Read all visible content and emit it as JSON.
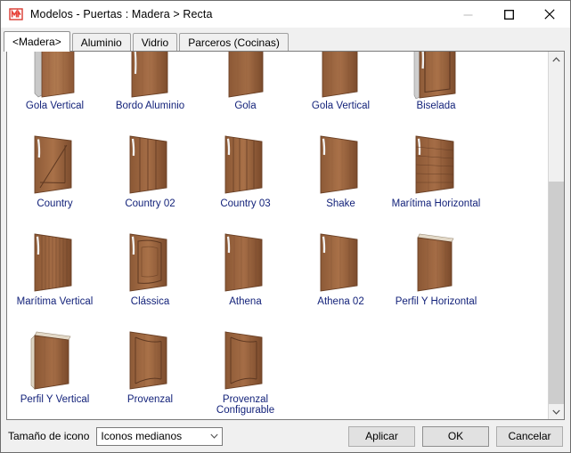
{
  "window": {
    "title": "Modelos - Puertas : Madera > Recta",
    "app_icon": "m-logo-icon",
    "caption": {
      "minimize": "minimize-icon",
      "maximize": "maximize-icon",
      "close": "close-icon"
    }
  },
  "tabs": [
    {
      "label": "<Madera>",
      "selected": true
    },
    {
      "label": "Aluminio",
      "selected": false
    },
    {
      "label": "Vidrio",
      "selected": false
    },
    {
      "label": "Parceros (Cocinas)",
      "selected": false
    }
  ],
  "grid": {
    "rows": [
      [
        {
          "label": "Gola Vertical",
          "style": "gola-vertical"
        },
        {
          "label": "Bordo Aluminio",
          "style": "bordo-aluminio"
        },
        {
          "label": "Gola",
          "style": "gola"
        },
        {
          "label": "Gola Vertical",
          "style": "gola-vertical-2"
        },
        {
          "label": "Biselada",
          "style": "biselada"
        }
      ],
      [
        {
          "label": "Country",
          "style": "country"
        },
        {
          "label": "Country 02",
          "style": "country-02"
        },
        {
          "label": "Country 03",
          "style": "country-03"
        },
        {
          "label": "Shake",
          "style": "shake"
        },
        {
          "label": "Marítima Horizontal",
          "style": "maritima-horizontal"
        }
      ],
      [
        {
          "label": "Marítima Vertical",
          "style": "maritima-vertical"
        },
        {
          "label": "Clássica",
          "style": "classica"
        },
        {
          "label": "Athena",
          "style": "athena"
        },
        {
          "label": "Athena 02",
          "style": "athena-02"
        },
        {
          "label": "Perfil Y Horizontal",
          "style": "perfil-y-horizontal"
        }
      ],
      [
        {
          "label": "Perfil Y Vertical",
          "style": "perfil-y-vertical"
        },
        {
          "label": "Provenzal",
          "style": "provenzal"
        },
        {
          "label": "Provenzal Configurable",
          "style": "provenzal-configurable"
        }
      ]
    ]
  },
  "scrollbar": {
    "up_icon": "chevron-up-icon",
    "down_icon": "chevron-down-icon",
    "thumb_top_pct": 34,
    "thumb_height_pct": 66
  },
  "bottom": {
    "icon_size_label": "Tamaño de icono",
    "icon_size_value": "Iconos medianos",
    "icon_size_options": [
      "Iconos medianos"
    ],
    "dropdown_icon": "chevron-down-icon",
    "apply_label": "Aplicar",
    "ok_label": "OK",
    "cancel_label": "Cancelar"
  },
  "colors": {
    "label_text": "#13227a",
    "window_bg": "#f0f0f0",
    "content_bg": "#ffffff",
    "wood_light": "#b07a50",
    "wood_mid": "#96603c",
    "wood_dark": "#7a4c2e",
    "wood_edge": "#6b4126",
    "accent_red": "#e8433a"
  }
}
